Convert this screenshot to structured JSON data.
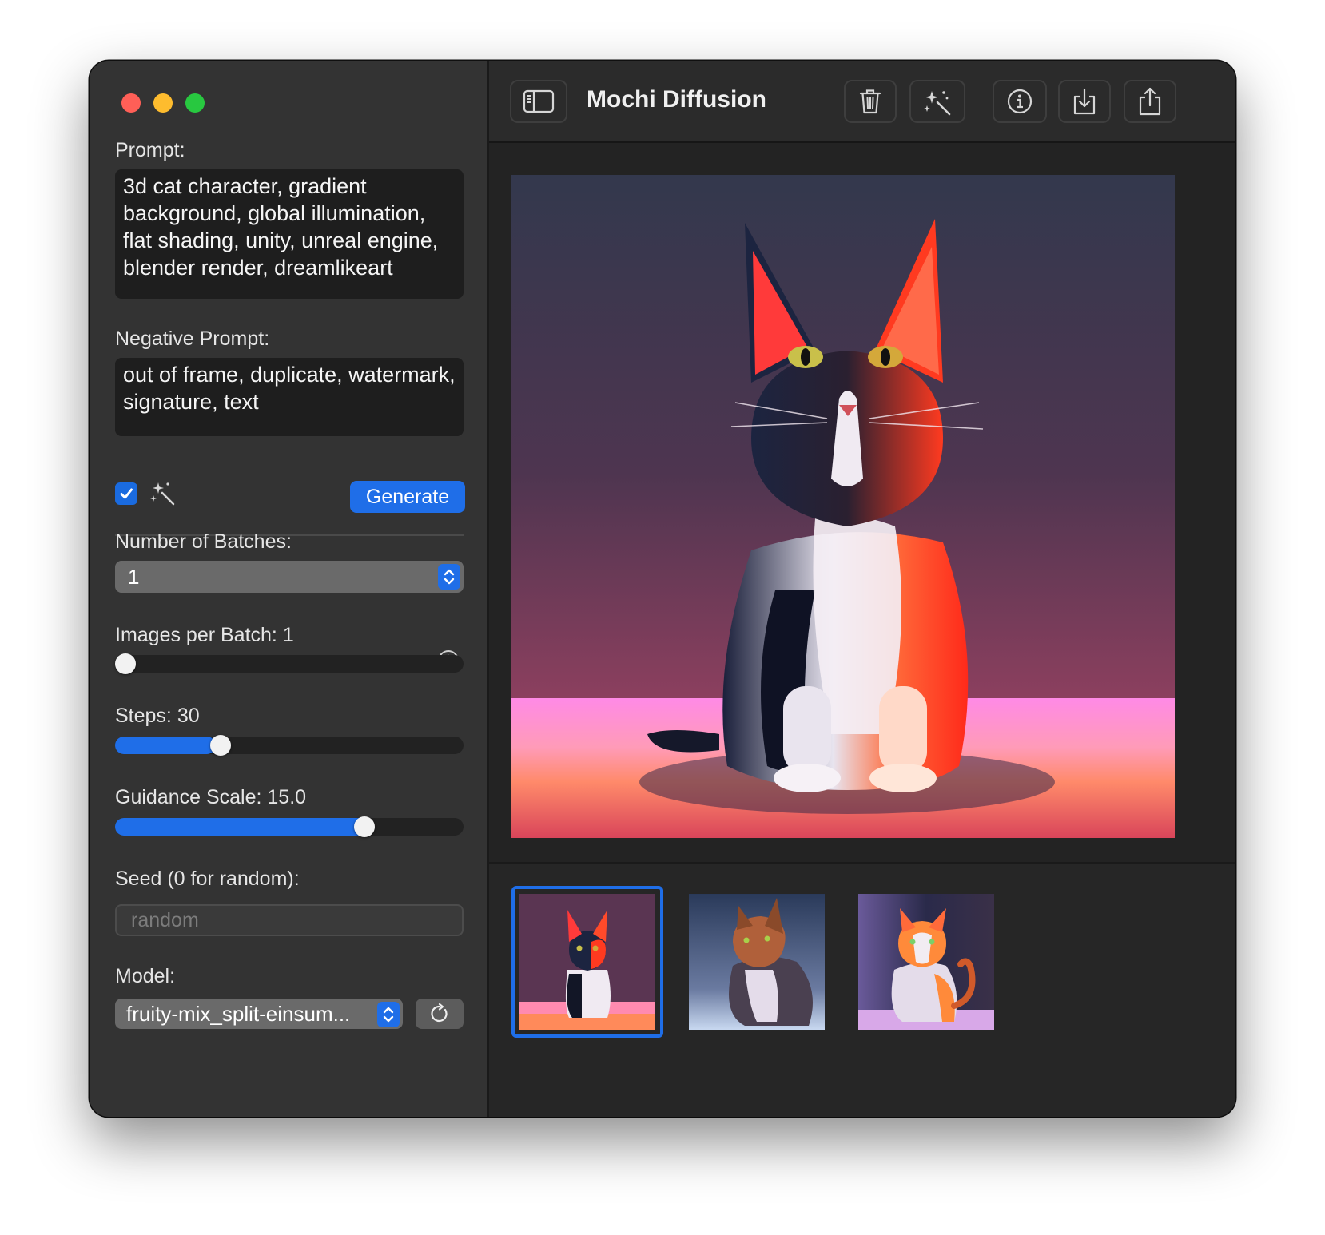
{
  "window": {
    "title": "Mochi Diffusion"
  },
  "sidebar": {
    "prompt_label": "Prompt:",
    "prompt_value": "3d cat character, gradient background, global illumination, flat shading, unity, unreal engine, blender render, dreamlikeart",
    "negative_label": "Negative Prompt:",
    "negative_value": "out of frame, duplicate, watermark, signature, text",
    "upscale_checked": true,
    "generate_label": "Generate",
    "batches_label": "Number of Batches:",
    "batches_value": "1",
    "images_per_batch_label": "Images per Batch: 1",
    "images_per_batch_level": 0.0,
    "steps_label": "Steps: 30",
    "steps_level": 0.29,
    "guidance_label": "Guidance Scale: 15.0",
    "guidance_level": 0.73,
    "seed_label": "Seed (0 for random):",
    "seed_placeholder": "random",
    "model_label": "Model:",
    "model_value": "fruity-mix_split-einsum..."
  },
  "toolbar": {
    "buttons": [
      "sidebar-toggle-icon",
      "trash-icon",
      "sparkles-icon",
      "info-icon",
      "download-icon",
      "share-icon"
    ]
  },
  "gallery": {
    "selected_index": 0,
    "thumbnails": [
      "cat-1",
      "cat-2",
      "cat-3"
    ]
  },
  "colors": {
    "accent": "#1f6ee8",
    "sidebar_bg": "#333333",
    "main_bg": "#232323"
  }
}
